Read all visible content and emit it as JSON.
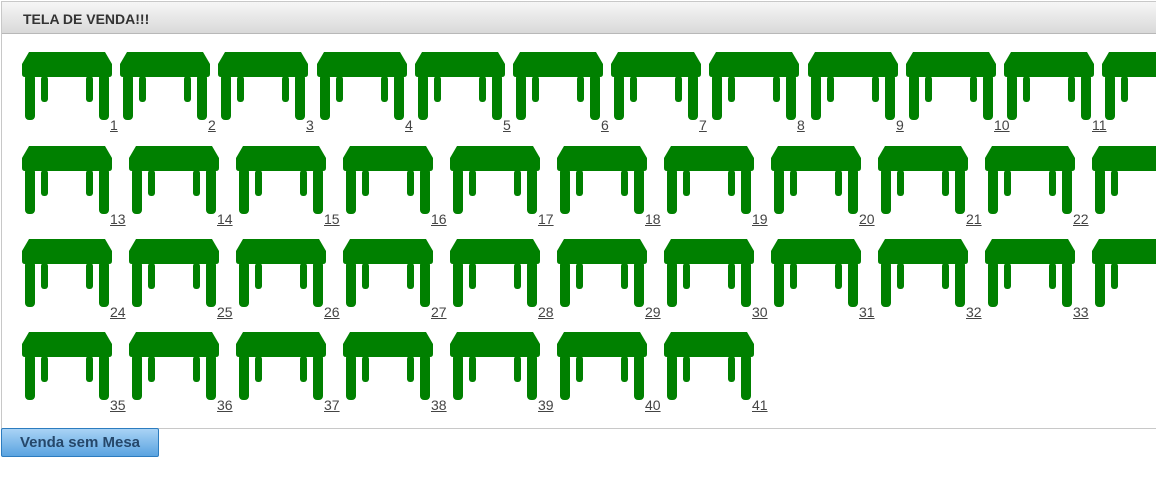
{
  "panel": {
    "title": "TELA DE VENDA!!!"
  },
  "table_color": "#008000",
  "table_icon": "table-icon",
  "rows": [
    [
      "1",
      "2",
      "3",
      "4",
      "5",
      "6",
      "7",
      "8",
      "9",
      "10",
      "11",
      ""
    ],
    [
      "13",
      "14",
      "15",
      "16",
      "17",
      "18",
      "19",
      "20",
      "21",
      "22",
      ""
    ],
    [
      "24",
      "25",
      "26",
      "27",
      "28",
      "29",
      "30",
      "31",
      "32",
      "33",
      ""
    ],
    [
      "35",
      "36",
      "37",
      "38",
      "39",
      "40",
      "41"
    ]
  ],
  "footer": {
    "button_label": "Venda sem Mesa"
  }
}
